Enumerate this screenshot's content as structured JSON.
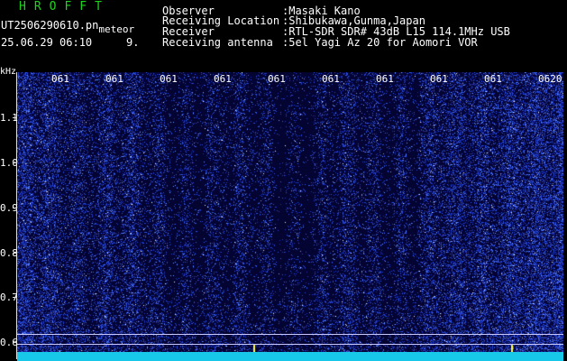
{
  "header": {
    "app_title": "HROFFT",
    "filename": "UT2506290610.pn",
    "filename_suffix": "meteor",
    "datetime": "25.06.29 06:10",
    "index": "9.",
    "info_rows": [
      {
        "label": "Observer",
        "value": ":Masaki Kano"
      },
      {
        "label": "Receiving Location",
        "value": ":Shibukawa,Gunma,Japan"
      },
      {
        "label": "Receiver",
        "value": ":RTL-SDR SDR# 43dB L15 114.1MHz USB"
      },
      {
        "label": "Receiving antenna",
        "value": ":5el Yagi Az 20 for Aomori VOR"
      }
    ]
  },
  "y_axis": {
    "unit": "kHz",
    "ticks": [
      "1.1",
      "1.0",
      "0.9",
      "0.8",
      "0.7",
      "0.6"
    ]
  },
  "time_axis": {
    "labels": [
      "061",
      "061",
      "061",
      "061",
      "061",
      "061",
      "061",
      "061",
      "061",
      "0620"
    ]
  },
  "colors": {
    "background": "#000000",
    "title": "#1fd41f",
    "text": "#ffffff",
    "spectrogram_noise": "#2a3cff",
    "baseline": "#18c8e8",
    "marker": "#ffff40"
  }
}
